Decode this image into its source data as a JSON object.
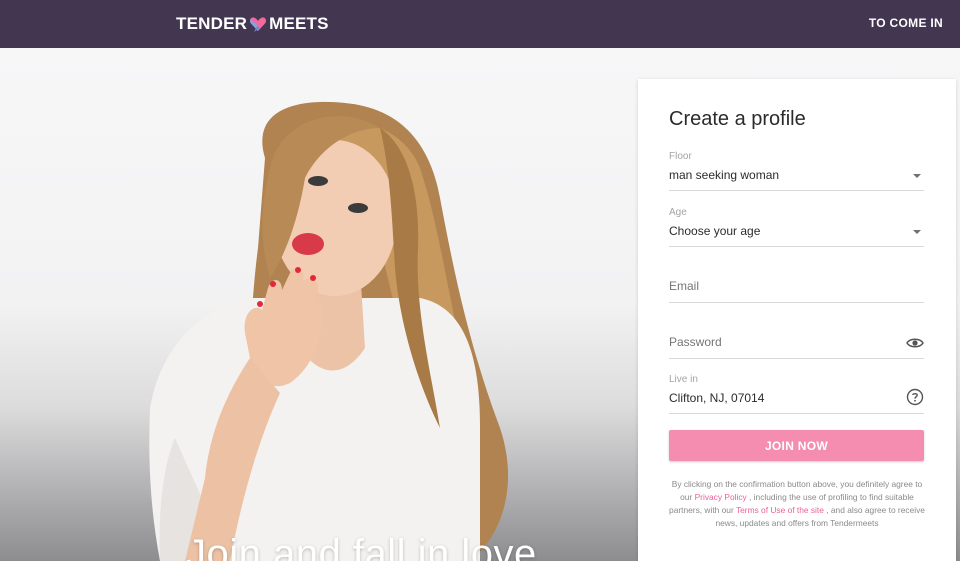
{
  "header": {
    "logo_left": "TENDER",
    "logo_right": "MEETS",
    "login_label": "TO COME IN",
    "background": "#433651"
  },
  "hero": {
    "headline": "Join and fall in love"
  },
  "form": {
    "title": "Create a profile",
    "floor": {
      "label": "Floor",
      "value": "man seeking woman"
    },
    "age": {
      "label": "Age",
      "value": "Choose your age"
    },
    "email": {
      "placeholder": "Email"
    },
    "password": {
      "placeholder": "Password"
    },
    "location": {
      "label": "Live in",
      "value": "Clifton, NJ, 07014"
    },
    "join_label": "JOIN NOW",
    "terms": {
      "part1": "By clicking on the confirmation button above, you definitely agree to our",
      "privacy_link": "Privacy Policy",
      "part2": ", including the use of profiling to find suitable partners, with our",
      "terms_link": "Terms of Use of the site",
      "part3": ", and also agree to receive news, updates and offers from Tendermeets"
    }
  },
  "colors": {
    "accent": "#f48db0",
    "link": "#e9629a",
    "header": "#433651"
  },
  "icons": [
    "heart-logo-icon",
    "dropdown-caret-icon",
    "eye-icon",
    "help-icon"
  ]
}
